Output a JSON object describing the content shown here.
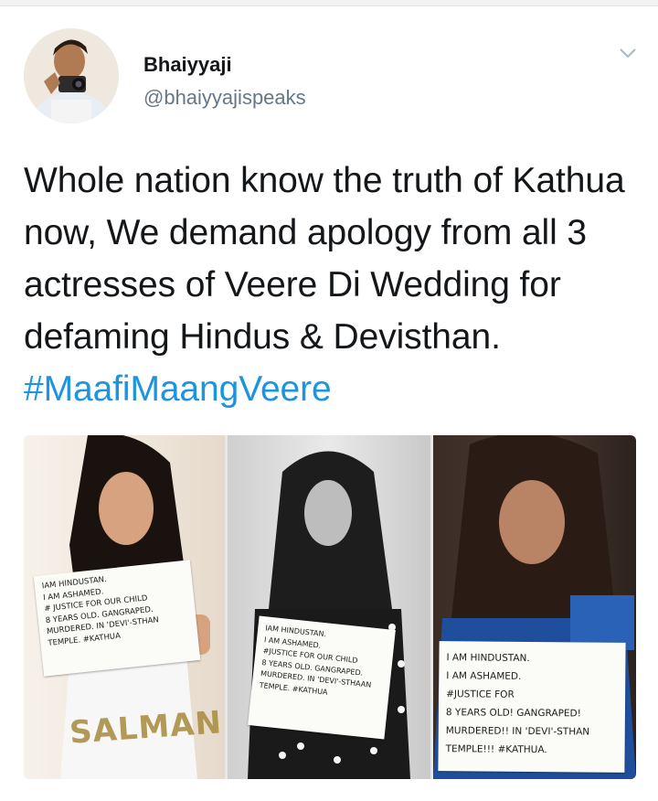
{
  "tweet": {
    "display_name": "Bhaiyyaji",
    "handle": "@bhaiyyajispeaks",
    "text_before": "Whole nation know the truth of Kathua now, We demand apology from all 3 actresses of Veere Di Wedding for defaming Hindus & Devisthan. ",
    "hashtag": "#MaafiMaangVeere",
    "hashtag_color": "#1b95e0",
    "menu_icon": "chevron-down-icon"
  },
  "media": {
    "photos": [
      {
        "sign_lines": [
          "IAM HINDUSTAN.",
          "I AM ASHAMED.",
          "# JUSTICE FOR OUR CHILD",
          "8 YEARS OLD. GANGRAPED.",
          "MURDERED. IN 'DEVI'-STHAN",
          "TEMPLE. #KATHUA"
        ],
        "shirt_text": "SALMAN"
      },
      {
        "sign_lines": [
          "IAM HINDUSTAN.",
          "I AM ASHAMED.",
          "#JUSTICE FOR OUR CHILD",
          "8 YEARS OLD. GANGRAPED.",
          "MURDERED. IN 'DEVI'-STHAAN",
          "TEMPLE. #KATHUA"
        ]
      },
      {
        "sign_lines": [
          "I AM HINDUSTAN.",
          "I AM ASHAMED.",
          "#JUSTICE FOR",
          "8 YEARS OLD! GANGRAPED!",
          "MURDERED!! IN 'DEVI'-STHAN",
          "TEMPLE!!! #KATHUA."
        ]
      }
    ]
  }
}
